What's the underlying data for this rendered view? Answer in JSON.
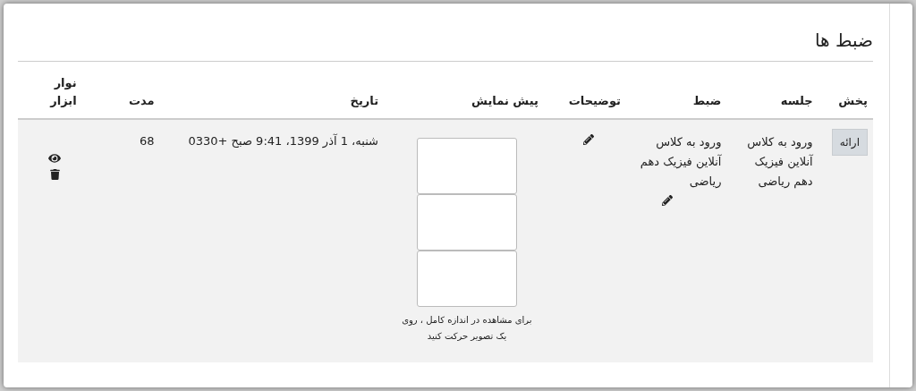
{
  "title": "ضبط ها",
  "table": {
    "columns": [
      "پخش",
      "جلسه",
      "ضبط",
      "توضیحات",
      "پیش نمایش",
      "تاریخ",
      "مدت",
      "نوار ابزار"
    ],
    "rows": [
      {
        "play_button": "ارائه",
        "session": "ورود به کلاس آنلاین فیزیک دهم ریاضی",
        "recording": "ورود به کلاس آنلاین فیزیک دهم ریاضی",
        "preview_hint": "برای مشاهده در اندازه کامل ، روی یک تصویر حرکت کنید",
        "previews": [
          {
            "kind": "thumbnail"
          },
          {
            "kind": "thumbnail"
          },
          {
            "kind": "thumbnail"
          }
        ],
        "date": "شنبه، 1 آذر 1399، 9:41 صبح +0330",
        "duration": "68"
      }
    ]
  }
}
